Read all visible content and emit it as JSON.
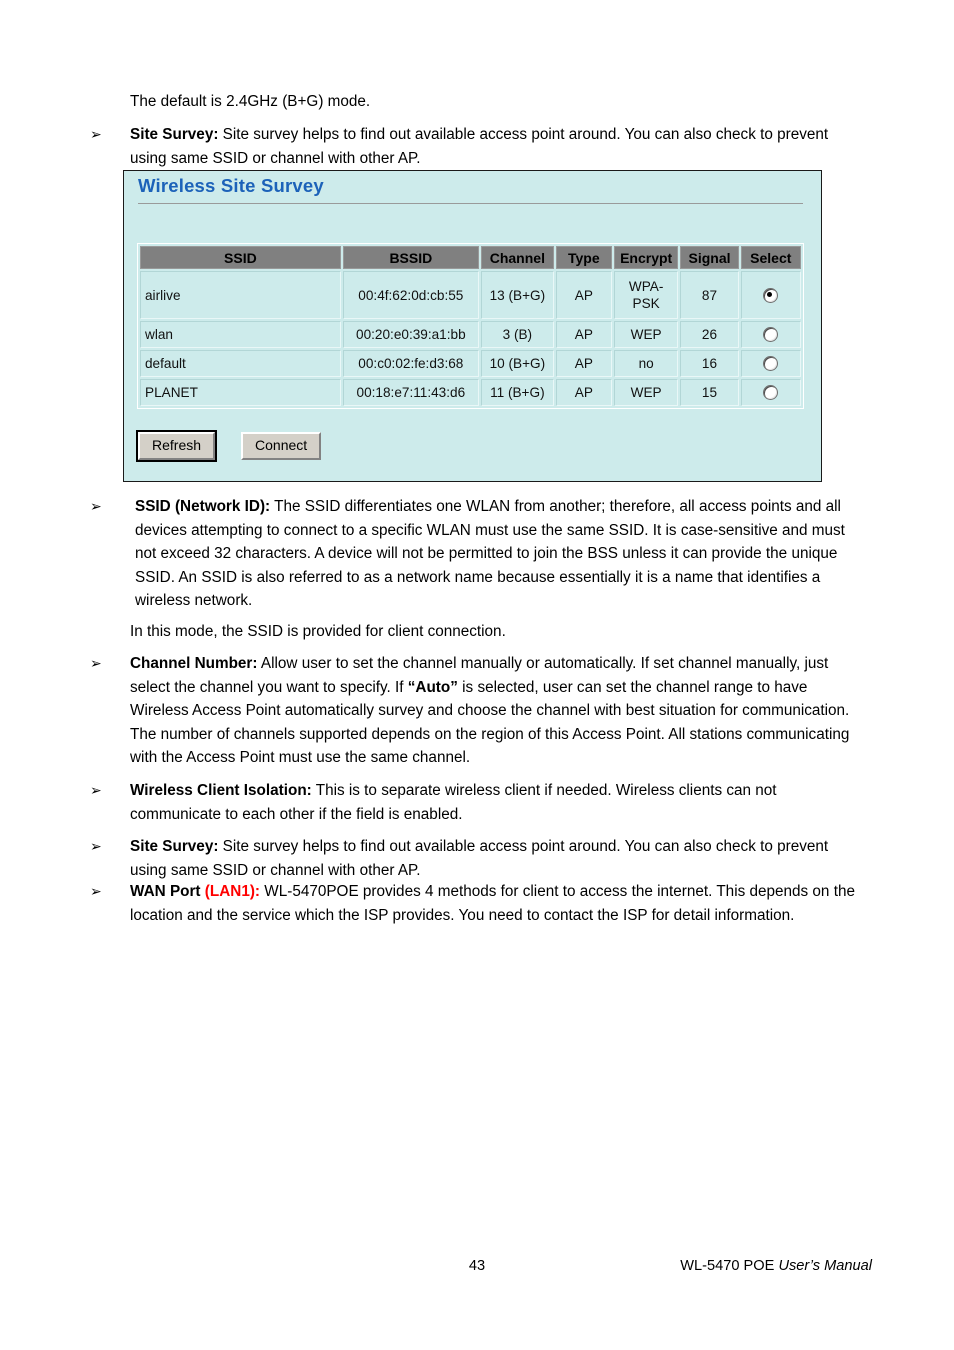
{
  "document": {
    "intro_paragraph": "The default is 2.4GHz (B+G) mode.",
    "bullet_marker": "➢"
  },
  "bullets": {
    "site_survey_top": {
      "lead": "Site Survey:",
      "body": " Site survey helps to find out available access point around. You can also check to prevent using same SSID or channel with other AP."
    },
    "ssid_network_id": {
      "lead": "SSID (Network ID):",
      "body": " The SSID differentiates one WLAN from another; therefore, all access points and all devices attempting to connect to a specific WLAN must use the same SSID. It is case-sensitive and must not exceed 32 characters.    A device will not be permitted to join the BSS unless it can provide the unique SSID. An SSID is also referred to as a network name because essentially it is a name that identifies a wireless network."
    },
    "ssid_note": "In this mode, the SSID is provided for client connection.",
    "channel_number": {
      "lead": "Channel Number:",
      "body_part1": " Allow user to set the channel manually or automatically. If set channel manually, just select the channel you want to specify. If ",
      "auto_quoted": "“Auto”",
      "body_part2": " is selected, user can set the channel range to have Wireless Access Point automatically survey and choose the channel with best situation for communication. The number of channels supported depends on the region of this Access Point. All stations communicating with the Access Point must use the same channel."
    },
    "wireless_client_isolation": {
      "lead": "Wireless Client Isolation:",
      "body": " This is to separate wireless client if needed. Wireless clients can not communicate to each other if the field is enabled."
    },
    "site_survey_bottom": {
      "lead": "Site Survey:",
      "body": " Site survey helps to find out available access point around. You can also check to prevent using same SSID or channel with other AP."
    },
    "wan_port": {
      "lead": "WAN Port",
      "lan_label": " (LAN1):",
      "body": " WL-5470POE provides 4 methods for client to access the internet. This depends on the location and the service which the ISP provides. You need to contact the ISP for detail information."
    }
  },
  "site_survey_panel": {
    "title": "Wireless Site Survey",
    "columns": [
      "SSID",
      "BSSID",
      "Channel",
      "Type",
      "Encrypt",
      "Signal",
      "Select"
    ],
    "rows": [
      {
        "ssid": "airlive",
        "bssid": "00:4f:62:0d:cb:55",
        "channel": "13 (B+G)",
        "type": "AP",
        "encrypt": "WPA-PSK",
        "encrypt_line1": "WPA-",
        "encrypt_line2": "PSK",
        "signal": "87",
        "selected": true
      },
      {
        "ssid": "wlan",
        "bssid": "00:20:e0:39:a1:bb",
        "channel": "3 (B)",
        "type": "AP",
        "encrypt": "WEP",
        "signal": "26",
        "selected": false
      },
      {
        "ssid": "default",
        "bssid": "00:c0:02:fe:d3:68",
        "channel": "10 (B+G)",
        "type": "AP",
        "encrypt": "no",
        "signal": "16",
        "selected": false
      },
      {
        "ssid": "PLANET",
        "bssid": "00:18:e7:11:43:d6",
        "channel": "11 (B+G)",
        "type": "AP",
        "encrypt": "WEP",
        "signal": "15",
        "selected": false
      }
    ],
    "buttons": {
      "refresh": "Refresh",
      "connect": "Connect"
    },
    "colors": {
      "panel_background": "#cdebeb",
      "panel_border": "#1a1a1a",
      "title_color": "#1c62b9",
      "header_background": "#808080",
      "button_face": "#d4d0c8"
    }
  },
  "footer": {
    "page_number": "43",
    "manual_model": "WL-5470 POE ",
    "manual_label": "User’s Manual"
  }
}
